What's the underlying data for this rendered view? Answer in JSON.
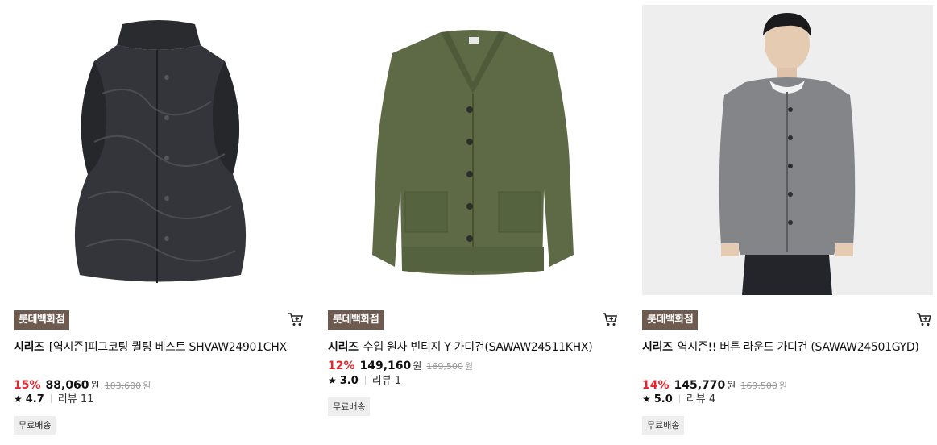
{
  "products": [
    {
      "store_badge": "롯데백화점",
      "brand": "시리즈",
      "name": "[역시즌]피그코팅 퀼팅 베스트 SHVAW24901CHX",
      "discount": "15%",
      "sale_price": "88,060",
      "currency": "원",
      "original_price": "103,600",
      "original_currency": "원",
      "rating": "4.7",
      "review_text": "리뷰 11",
      "shipping_chip": "무료배송",
      "image_icon": "quilted-vest-photo",
      "cart_icon": "cart-icon"
    },
    {
      "store_badge": "롯데백화점",
      "brand": "시리즈",
      "name": "수입 원사 빈티지 Y 가디건(SAWAW24511KHX)",
      "discount": "12%",
      "sale_price": "149,160",
      "currency": "원",
      "original_price": "169,500",
      "original_currency": "원",
      "rating": "3.0",
      "review_text": "리뷰 1",
      "shipping_chip": "무료배송",
      "image_icon": "olive-cardigan-photo",
      "cart_icon": "cart-icon"
    },
    {
      "store_badge": "롯데백화점",
      "brand": "시리즈",
      "name": "역시즌!! 버튼 라운드 가디건 (SAWAW24501GYD)",
      "discount": "14%",
      "sale_price": "145,770",
      "currency": "원",
      "original_price": "169,500",
      "original_currency": "원",
      "rating": "5.0",
      "review_text": "리뷰 4",
      "shipping_chip": "무료배송",
      "image_icon": "model-gray-cardigan-photo",
      "cart_icon": "cart-icon"
    }
  ],
  "colors": {
    "badge_bg": "#6e5a4f",
    "discount": "#e8262e",
    "chip_bg": "#eeeeee"
  }
}
